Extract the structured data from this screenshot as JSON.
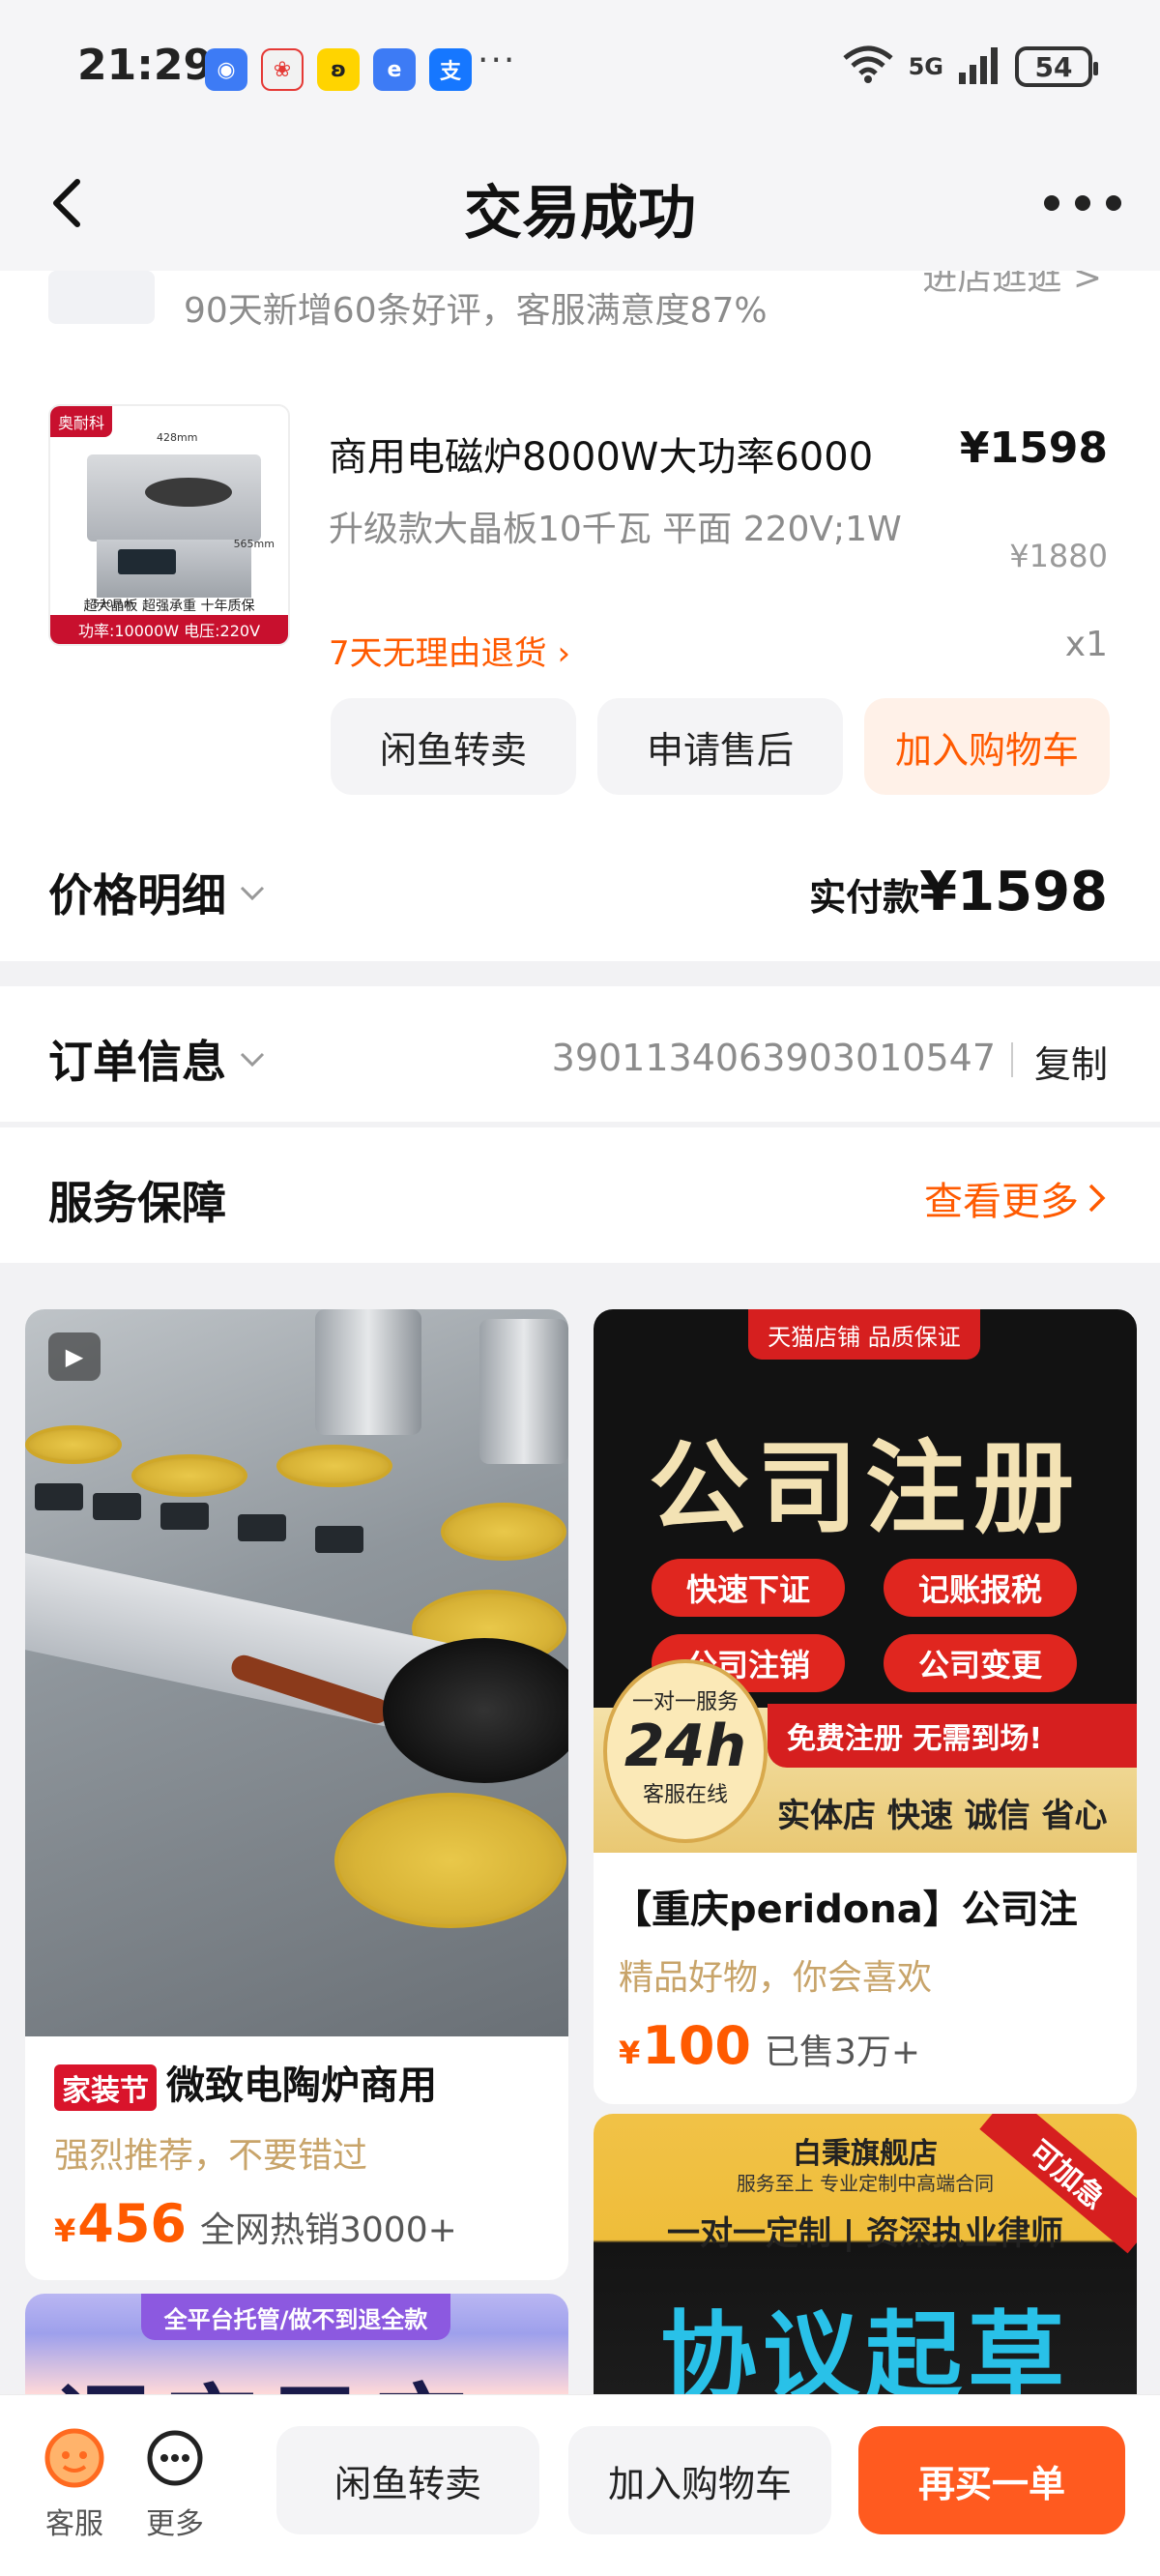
{
  "status_bar": {
    "time": "21:29",
    "signal": "5G",
    "wifi": "6",
    "battery": "54"
  },
  "nav": {
    "title": "交易成功"
  },
  "shop": {
    "review_summary": "90天新增60条好评，客服满意度87%",
    "link_text": "进店逛逛 >"
  },
  "product": {
    "tag": "奥耐科",
    "title": "商用电磁炉8000W大功率6000",
    "price": "¥1598",
    "variant": "升级款大晶板10千瓦 平面 220V;1W",
    "original_price": "¥1880",
    "return_policy": "7天无理由退货",
    "quantity": "x1",
    "image_specs": "超大晶板  超强承重  十年质保",
    "image_footer": "功率:10000W  电压:220V",
    "dim_top": "428mm",
    "dim_side": "565mm",
    "dim_bottom": "520mm",
    "actions": [
      "闲鱼转卖",
      "申请售后",
      "加入购物车"
    ]
  },
  "price_detail": {
    "label": "价格明细",
    "paid_label": "实付款",
    "paid_amount": "¥1598"
  },
  "order_info": {
    "label": "订单信息",
    "order_number": "3901134063903010547",
    "copy_label": "复制"
  },
  "service": {
    "label": "服务保障",
    "see_more": "查看更多"
  },
  "recommendations": [
    {
      "festival_tag": "家装节",
      "name": "微致电陶炉商用",
      "subtitle": "强烈推荐，不要错过",
      "price_symbol": "¥",
      "price": "456",
      "sales": "全网热销3000+"
    },
    {
      "name": "【重庆peridona】公司注",
      "subtitle": "精品好物，你会喜欢",
      "price_symbol": "¥",
      "price": "100",
      "sales": "已售3万+",
      "poster": {
        "top_banner": "天猫店铺 品质保证",
        "title": "公司注册",
        "pills": [
          "快速下证",
          "记账报税",
          "公司注销",
          "公司变更"
        ],
        "circle_top": "一对一服务",
        "circle_big": "24h",
        "circle_bottom": "客服在线",
        "band_red": "免费注册 无需到场!",
        "band_text": "实体店 快速 诚信 省心"
      }
    },
    {
      "poster": {
        "corner": "可加急",
        "store": "白秉旗舰店",
        "sub": "服务至上  专业定制中高端合同",
        "band": "一对一定制 | 资深执业律师",
        "big": "协议起草"
      }
    },
    {
      "poster": {
        "top_banner": "全平台托管/做不到退全款",
        "big": "评店目宝"
      }
    }
  ],
  "bottom_bar": {
    "service_label": "客服",
    "more_label": "更多",
    "buttons": [
      "闲鱼转卖",
      "加入购物车",
      "再买一单"
    ]
  },
  "colors": {
    "accent": "#ff5a1f",
    "gold_text": "#c8a46a",
    "gray_text": "#8c8c8c"
  }
}
